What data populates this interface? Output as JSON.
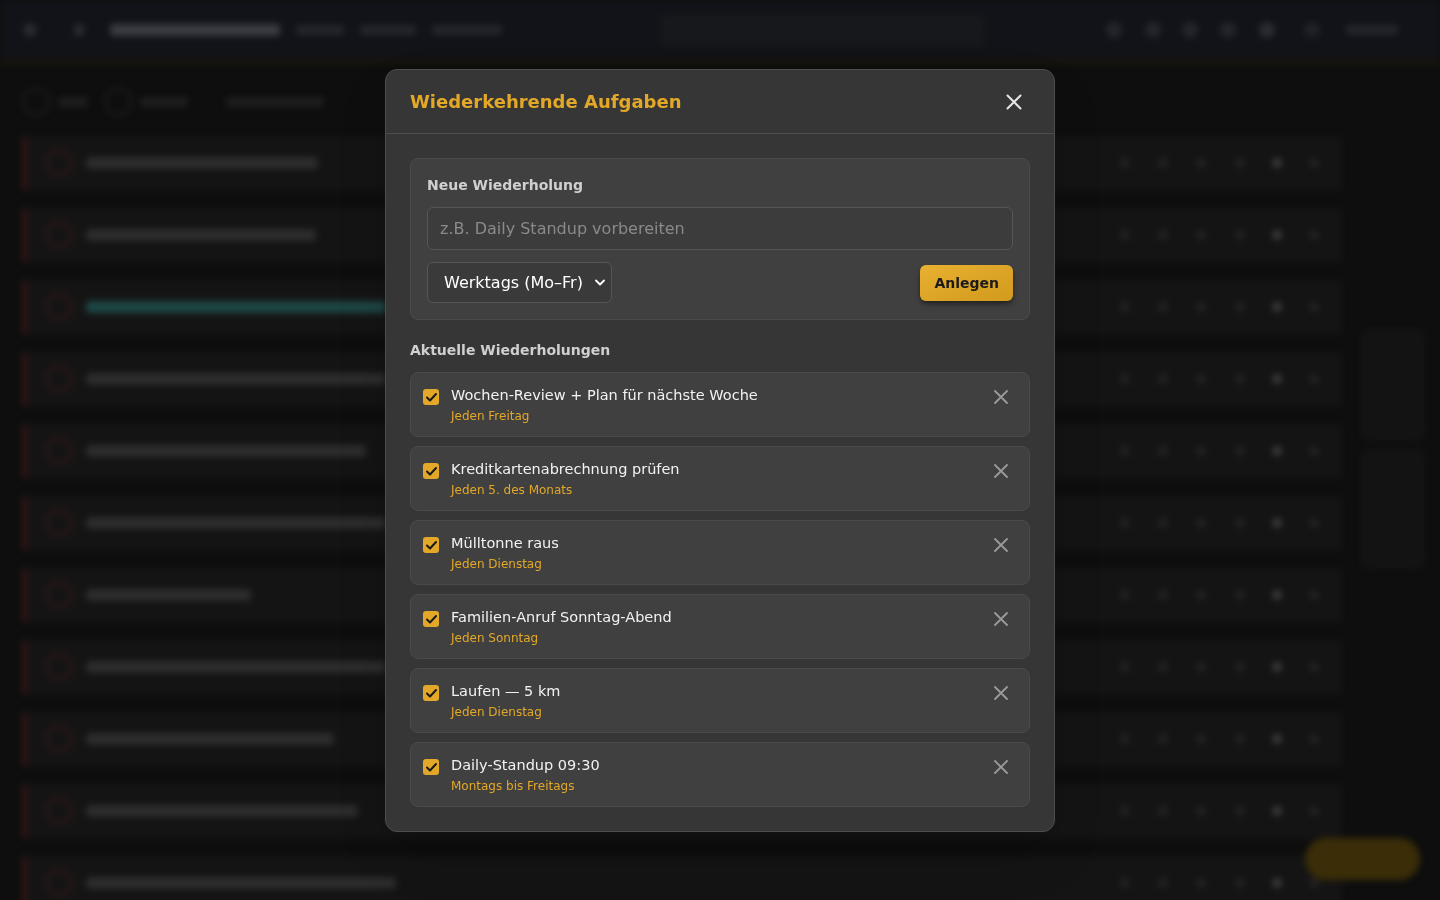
{
  "dialog": {
    "title": "Wiederkehrende Aufgaben"
  },
  "new_form": {
    "heading": "Neue Wiederholung",
    "name_field": {
      "placeholder": "z.B. Daily Standup vorbereiten"
    },
    "frequency_select": {
      "value": "Werktags (Mo–Fr)"
    },
    "submit_button": "Anlegen"
  },
  "current": {
    "heading": "Aktuelle Wiederholungen",
    "items": [
      {
        "title": "Wochen-Review + Plan für nächste Woche",
        "schedule": "Jeden Freitag",
        "checked": true
      },
      {
        "title": "Kreditkartenabrechnung prüfen",
        "schedule": "Jeden 5. des Monats",
        "checked": true
      },
      {
        "title": "Mülltonne raus",
        "schedule": "Jeden Dienstag",
        "checked": true
      },
      {
        "title": "Familien-Anruf Sonntag-Abend",
        "schedule": "Jeden Sonntag",
        "checked": true
      },
      {
        "title": "Laufen — 5 km",
        "schedule": "Jeden Dienstag",
        "checked": true
      },
      {
        "title": "Daily-Standup 09:30",
        "schedule": "Montags bis Freitags",
        "checked": true
      }
    ]
  }
}
